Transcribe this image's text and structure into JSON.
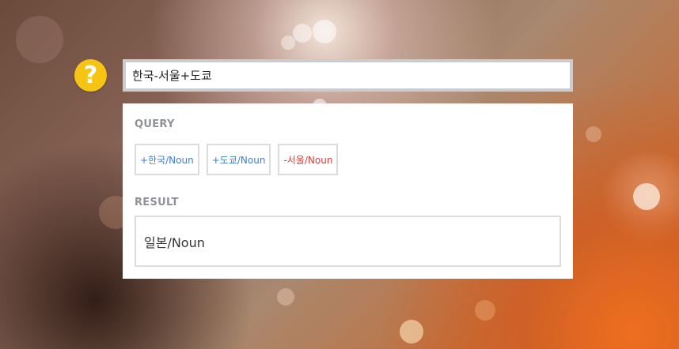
{
  "help": {
    "icon": "question-mark-icon",
    "glyph": "?",
    "color": "#f6c514"
  },
  "search": {
    "value": "한국-서울+도쿄"
  },
  "query": {
    "label": "QUERY",
    "tags": [
      {
        "text": "+한국/Noun",
        "sign": "plus",
        "color": "#3d7fd4"
      },
      {
        "text": "+도쿄/Noun",
        "sign": "plus",
        "color": "#3d7fd4"
      },
      {
        "text": "-서울/Noun",
        "sign": "minus",
        "color": "#d2403a"
      }
    ]
  },
  "result": {
    "label": "RESULT",
    "value": "일본/Noun"
  }
}
